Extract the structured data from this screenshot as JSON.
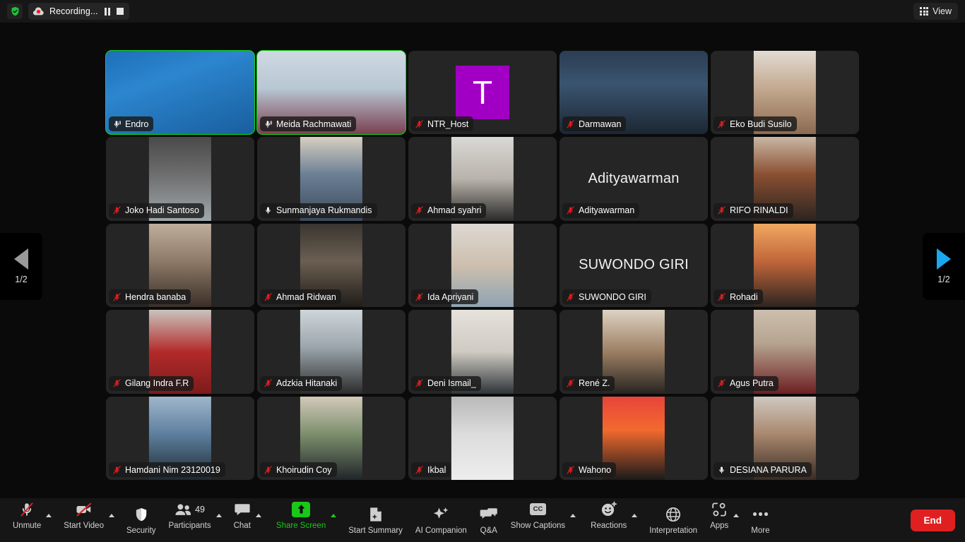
{
  "topbar": {
    "shield_icon": "shield-check-icon",
    "recording_label": "Recording...",
    "recording_icon": "cloud-record-icon",
    "pause_icon": "pause-icon",
    "stop_icon": "stop-icon",
    "view_label": "View",
    "view_icon": "grid-icon"
  },
  "pager": {
    "prev_label": "1/2",
    "next_label": "1/2",
    "prev_icon": "chevron-left-icon",
    "next_icon": "chevron-right-icon",
    "prev_color": "#9a9a9a",
    "next_color": "#1aa7f0"
  },
  "gallery": {
    "active_border_color": "#13d413",
    "tiles": [
      {
        "name": "Endro",
        "muted": false,
        "speaking": true,
        "video": true,
        "kind": "video",
        "vid": "endro"
      },
      {
        "name": "Meida Rachmawati",
        "muted": false,
        "speaking": true,
        "video": true,
        "kind": "video",
        "vid": "meida"
      },
      {
        "name": "NTR_Host",
        "muted": true,
        "speaking": false,
        "video": false,
        "kind": "avatar",
        "avatar_letter": "T",
        "avatar_color": "#a100c4"
      },
      {
        "name": "Darmawan",
        "muted": true,
        "speaking": false,
        "video": true,
        "kind": "video",
        "vid": "darmawan"
      },
      {
        "name": "Eko Budi Susilo",
        "muted": true,
        "speaking": false,
        "video": true,
        "kind": "video",
        "vid": "eko"
      },
      {
        "name": "Joko Hadi Santoso",
        "muted": true,
        "speaking": false,
        "video": true,
        "kind": "video",
        "vid": "joko"
      },
      {
        "name": "Sunmanjaya Rukmandis",
        "muted": false,
        "speaking": false,
        "video": true,
        "kind": "video",
        "vid": "sunman"
      },
      {
        "name": "Ahmad syahri",
        "muted": true,
        "speaking": false,
        "video": true,
        "kind": "video",
        "vid": "syahri"
      },
      {
        "name": "Adityawarman",
        "muted": true,
        "speaking": false,
        "video": false,
        "kind": "name"
      },
      {
        "name": "RIFO RINALDI",
        "muted": true,
        "speaking": false,
        "video": true,
        "kind": "video",
        "vid": "rifo"
      },
      {
        "name": "Hendra banaba",
        "muted": true,
        "speaking": false,
        "video": true,
        "kind": "video",
        "vid": "hendra"
      },
      {
        "name": "Ahmad Ridwan",
        "muted": true,
        "speaking": false,
        "video": true,
        "kind": "video",
        "vid": "ridwan"
      },
      {
        "name": "Ida Apriyani",
        "muted": true,
        "speaking": false,
        "video": true,
        "kind": "video",
        "vid": "ida"
      },
      {
        "name": "SUWONDO GIRI",
        "muted": true,
        "speaking": false,
        "video": false,
        "kind": "name"
      },
      {
        "name": "Rohadi",
        "muted": true,
        "speaking": false,
        "video": true,
        "kind": "video",
        "vid": "rohadi"
      },
      {
        "name": "Gilang Indra F.R",
        "muted": true,
        "speaking": false,
        "video": true,
        "kind": "video",
        "vid": "gilang"
      },
      {
        "name": "Adzkia Hitanaki",
        "muted": true,
        "speaking": false,
        "video": true,
        "kind": "video",
        "vid": "adzkia"
      },
      {
        "name": "Deni Ismail_",
        "muted": true,
        "speaking": false,
        "video": true,
        "kind": "video",
        "vid": "deni"
      },
      {
        "name": "René Z.",
        "muted": true,
        "speaking": false,
        "video": true,
        "kind": "video",
        "vid": "rene"
      },
      {
        "name": "Agus Putra",
        "muted": true,
        "speaking": false,
        "video": true,
        "kind": "video",
        "vid": "agus"
      },
      {
        "name": "Hamdani Nim 23120019",
        "muted": true,
        "speaking": false,
        "video": true,
        "kind": "video",
        "vid": "hamdani"
      },
      {
        "name": "Khoirudin Coy",
        "muted": true,
        "speaking": false,
        "video": true,
        "kind": "video",
        "vid": "khoirudin"
      },
      {
        "name": "Ikbal",
        "muted": true,
        "speaking": false,
        "video": true,
        "kind": "video",
        "vid": "ikbal"
      },
      {
        "name": "Wahono",
        "muted": true,
        "speaking": false,
        "video": true,
        "kind": "video",
        "vid": "wahono"
      },
      {
        "name": "DESIANA PARURA",
        "muted": false,
        "speaking": false,
        "video": true,
        "kind": "video",
        "vid": "desiana"
      }
    ]
  },
  "toolbar": {
    "items": [
      {
        "label": "Unmute",
        "icon": "microphone-muted-icon",
        "caret": true,
        "highlight": false
      },
      {
        "label": "Start Video",
        "icon": "camera-muted-icon",
        "caret": true,
        "highlight": false
      },
      {
        "label": "Security",
        "icon": "shield-icon",
        "caret": false,
        "highlight": false
      },
      {
        "label": "Participants",
        "icon": "people-icon",
        "caret": true,
        "highlight": false,
        "badge": "49"
      },
      {
        "label": "Chat",
        "icon": "chat-bubble-icon",
        "caret": true,
        "highlight": false
      },
      {
        "label": "Share Screen",
        "icon": "share-screen-icon",
        "caret": true,
        "highlight": true
      },
      {
        "label": "Start Summary",
        "icon": "summary-doc-icon",
        "caret": false,
        "highlight": false
      },
      {
        "label": "AI Companion",
        "icon": "sparkle-icon",
        "caret": false,
        "highlight": false
      },
      {
        "label": "Q&A",
        "icon": "qa-bubbles-icon",
        "caret": false,
        "highlight": false
      },
      {
        "label": "Show Captions",
        "icon": "closed-caption-icon",
        "caret": true,
        "highlight": false
      },
      {
        "label": "Reactions",
        "icon": "reaction-smiley-icon",
        "caret": true,
        "highlight": false
      },
      {
        "label": "Interpretation",
        "icon": "globe-icon",
        "caret": false,
        "highlight": false
      },
      {
        "label": "Apps",
        "icon": "apps-icon",
        "caret": true,
        "highlight": false
      },
      {
        "label": "More",
        "icon": "more-dots-icon",
        "caret": false,
        "highlight": false
      }
    ],
    "end_label": "End",
    "end_color": "#e02020",
    "highlight_color": "#19c819"
  }
}
